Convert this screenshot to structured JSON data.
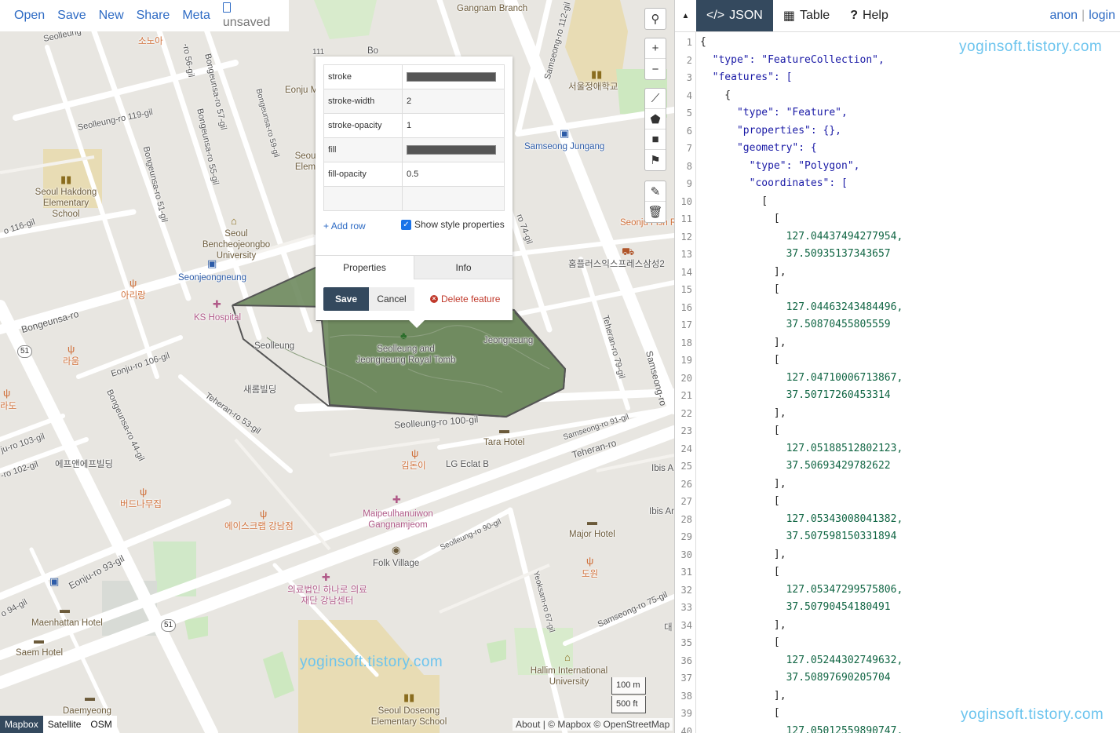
{
  "map_menu": {
    "open": "Open",
    "save": "Save",
    "new": "New",
    "share": "Share",
    "meta": "Meta",
    "unsaved": "unsaved"
  },
  "map_labels": {
    "seolleung_st": "Seolleung",
    "sonoa": "소노아",
    "ro56": "-ro 56-gil",
    "ro57": "Bongeunsa-ro 57-gil",
    "ro59": "Bongeunsa-ro 59-gil",
    "eonju_m": "Eonju M",
    "n111": "111",
    "bo": "Bo",
    "gangnam_branch": "Gangnam Branch",
    "samseong112": "Samseong-ro 112-gil",
    "seoul_jeong": "서울정애학교",
    "seolleung119": "Seolleung-ro 119-gil",
    "ro55": "Bongeunsa-ro 55-gil",
    "ro51": "Bongeunsa-ro 51-gil",
    "seoul_hakdong": "Seoul Hakdong Elementary School",
    "seoul_elem": "Seou Elem",
    "samseong_jungang": "Samseong Jungang",
    "ro116": "o 116-gil",
    "benche": "Seoul Bencheojeongbo University",
    "seonjeongneung": "Seonjeongneung",
    "ro74": "ro 74-gil",
    "seonju_fish": "Seonju Fish Re",
    "homeplus": "홈플러스익스프레스삼성2",
    "arirang": "아리랑",
    "ks_hospital": "KS Hospital",
    "bongeunsa_ro": "Bongeunsa-ro",
    "eonju106": "Eonju-ro 106-gil",
    "laum": "라움",
    "seolleung_park": "Seolleung",
    "royal_tomb": "Seolleung and Jeongneung Royal Tomb",
    "jeongneung": "Jeongneung",
    "teheran79": "Teheran-ro 79-gil",
    "samseong_ro": "Samseong-ro",
    "n51a": "51",
    "saerom": "새롬빌딩",
    "teheran53": "Teheran-ro 53-gil",
    "ro44": "Bongeunsa-ro 44-gil",
    "hwado": "라도",
    "ju103": "ju-ro 103-gil",
    "ro102": "-ro 102-gil",
    "fnf": "에프앤에프빌딩",
    "seolleung100": "Seolleung-ro 100-gil",
    "tara": "Tara Hotel",
    "samseong91": "Samseong-ro 91-gil",
    "teheran_ro": "Teheran-ro",
    "gimdoni": "김돈이",
    "lg_eclat": "LG Eclat B",
    "ibis1": "Ibis A",
    "birch": "버드나무집",
    "maipeul": "Maipeulhanuiwon Gangnamjeom",
    "ibis2": "Ibis Ar",
    "aisgrab": "에이스크랩 강남점",
    "major": "Major Hotel",
    "eonju93": "Eonju-ro 93-gil",
    "folk": "Folk Village",
    "seolleung90": "Seolleung-ro 90-gil",
    "dowon": "도원",
    "yeoksam67": "Yeoksam-ro 67-gil",
    "hana": "의료법인 하나로 의료재단 강남센터",
    "ro94": "o 94-gil",
    "maenhattan": "Maenhattan Hotel",
    "n51b": "51",
    "samseong75": "Samseong-ro 75-gil",
    "de": "대",
    "saem": "Saem Hotel",
    "hallim": "Hallim International University",
    "daemyeong": "Daemyeong",
    "doseong": "Seoul Doseong Elementary School"
  },
  "popup": {
    "rows": [
      {
        "key": "stroke",
        "value": "#555555"
      },
      {
        "key": "stroke-width",
        "value": "2"
      },
      {
        "key": "stroke-opacity",
        "value": "1"
      },
      {
        "key": "fill",
        "value": "#555555"
      },
      {
        "key": "fill-opacity",
        "value": "0.5"
      },
      {
        "key": "",
        "value": ""
      }
    ],
    "add_row": "Add row",
    "show_style": "Show style properties",
    "tab_properties": "Properties",
    "tab_info": "Info",
    "save": "Save",
    "cancel": "Cancel",
    "delete": "Delete feature"
  },
  "layers": {
    "mapbox": "Mapbox",
    "satellite": "Satellite",
    "osm": "OSM"
  },
  "attribution": "About | © Mapbox © OpenStreetMap",
  "scale": {
    "m": "100 m",
    "ft": "500 ft"
  },
  "watermark": "yoginsoft.tistory.com",
  "right_tabs": {
    "json": "JSON",
    "table": "Table",
    "help": "Help"
  },
  "user": {
    "anon": "anon",
    "login": "login"
  },
  "code_lines": [
    "{",
    "  \"type\": \"FeatureCollection\",",
    "  \"features\": [",
    "    {",
    "      \"type\": \"Feature\",",
    "      \"properties\": {},",
    "      \"geometry\": {",
    "        \"type\": \"Polygon\",",
    "        \"coordinates\": [",
    "          [",
    "            [",
    "              127.04437494277954,",
    "              37.50935137343657",
    "            ],",
    "            [",
    "              127.04463243484496,",
    "              37.50870455805559",
    "            ],",
    "            [",
    "              127.04710006713867,",
    "              37.50717260453314",
    "            ],",
    "            [",
    "              127.05188512802123,",
    "              37.50693429782622",
    "            ],",
    "            [",
    "              127.05343008041382,",
    "              37.507598150331894",
    "            ],",
    "            [",
    "              127.05347299575806,",
    "              37.50790454180491",
    "            ],",
    "            [",
    "              127.05244302749632,",
    "              37.50897690205704",
    "            ],",
    "            [",
    "              127.05012559890747,"
  ],
  "colors": {
    "accent": "#2e6bc4",
    "dark_bar": "#34495e",
    "polygon_fill": "#6e8a5e",
    "polygon_stroke": "#555555",
    "watermark": "#6cc4ee"
  }
}
